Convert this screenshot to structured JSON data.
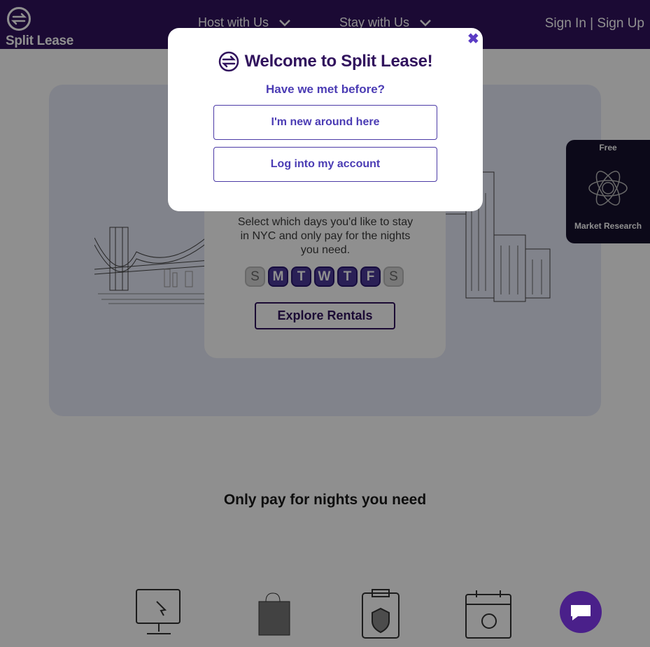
{
  "header": {
    "logo_text": "Split Lease",
    "nav": [
      {
        "label": "Host with Us"
      },
      {
        "label": "Stay with Us"
      }
    ],
    "auth_label": "Sign In | Sign Up"
  },
  "hero": {
    "description": "Select which days you'd like to stay in NYC and only pay for the nights you need.",
    "days": [
      "S",
      "M",
      "T",
      "W",
      "T",
      "F",
      "S"
    ],
    "explore_label": "Explore Rentals"
  },
  "side_tab": {
    "free_label": "Free",
    "label": "Market Research"
  },
  "section": {
    "title": "Only pay for nights you need"
  },
  "modal": {
    "close_symbol": "✖",
    "title": "Welcome to Split Lease!",
    "subtitle": "Have we met before?",
    "new_button": "I'm new around here",
    "login_button": "Log into my account"
  },
  "colors": {
    "brand": "#31135d",
    "accent": "#4b3cb4",
    "hero_bg": "#e7eaf8"
  }
}
